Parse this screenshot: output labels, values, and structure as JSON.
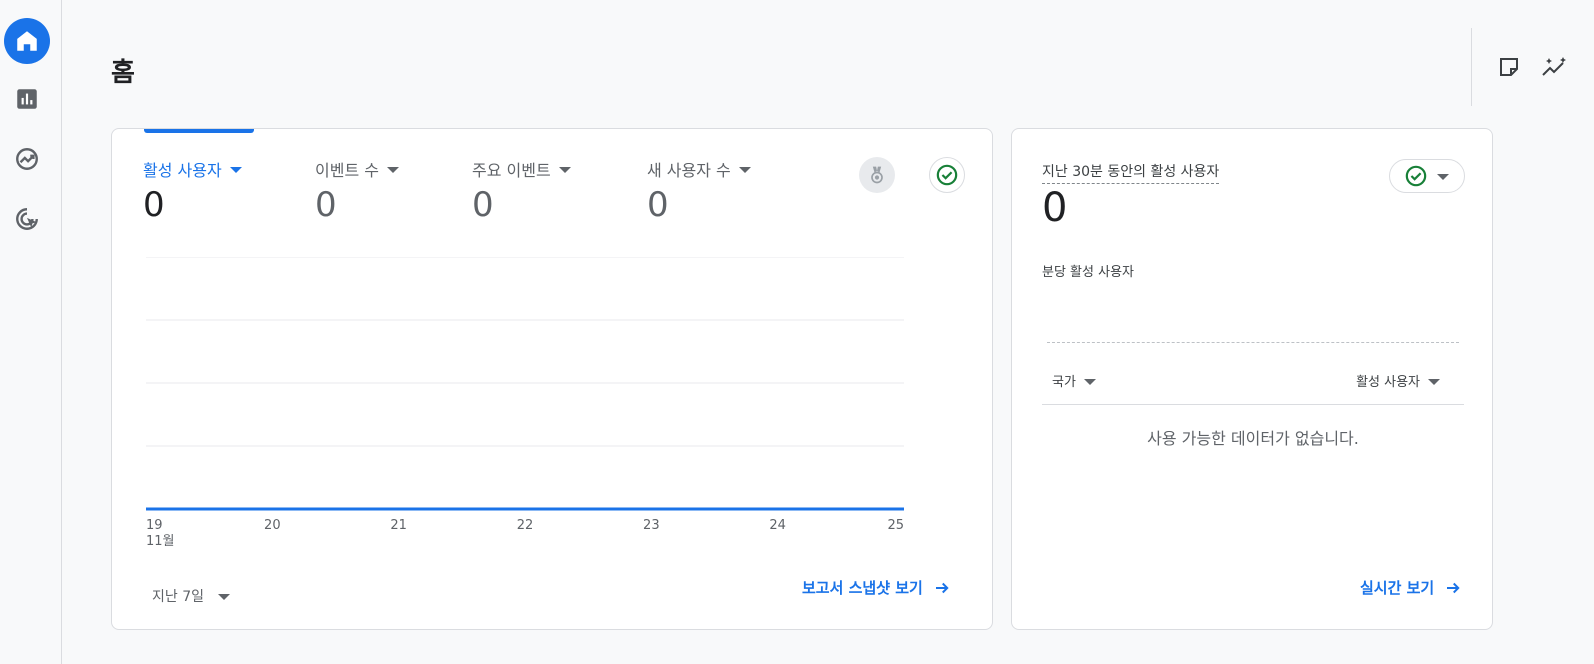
{
  "page": {
    "title": "홈"
  },
  "colors": {
    "accent": "#1a73e8",
    "success": "#188038",
    "text_muted": "#5f6368"
  },
  "rail": {
    "items": [
      {
        "icon": "home-icon",
        "active": true
      },
      {
        "icon": "bar-chart-icon",
        "active": false
      },
      {
        "icon": "trending-icon",
        "active": false
      },
      {
        "icon": "target-cursor-icon",
        "active": false
      }
    ]
  },
  "top_actions": {
    "icons": [
      "note-icon",
      "insights-sparkle-icon"
    ]
  },
  "overview": {
    "metrics": [
      {
        "label": "활성 사용자",
        "value": "0",
        "active": true
      },
      {
        "label": "이벤트 수",
        "value": "0",
        "active": false
      },
      {
        "label": "주요 이벤트",
        "value": "0",
        "active": false
      },
      {
        "label": "새 사용자 수",
        "value": "0",
        "active": false
      }
    ],
    "range_label": "지난 7일",
    "snapshot_link": "보고서 스냅샷 보기"
  },
  "chart_data": {
    "type": "line",
    "x": [
      "19",
      "20",
      "21",
      "22",
      "23",
      "24",
      "25"
    ],
    "x_sublabel": "11월",
    "series": [
      {
        "values": [
          0,
          0,
          0,
          0,
          0,
          0,
          0
        ]
      }
    ],
    "ylim": [
      0,
      4
    ],
    "grid": true,
    "color": "#1a73e8"
  },
  "realtime": {
    "title": "지난 30분 동안의 활성 사용자",
    "value": "0",
    "per_minute_label": "분당 활성 사용자",
    "col_country": "국가",
    "col_active": "활성 사용자",
    "empty_text": "사용 가능한 데이터가 없습니다.",
    "link": "실시간 보기"
  }
}
